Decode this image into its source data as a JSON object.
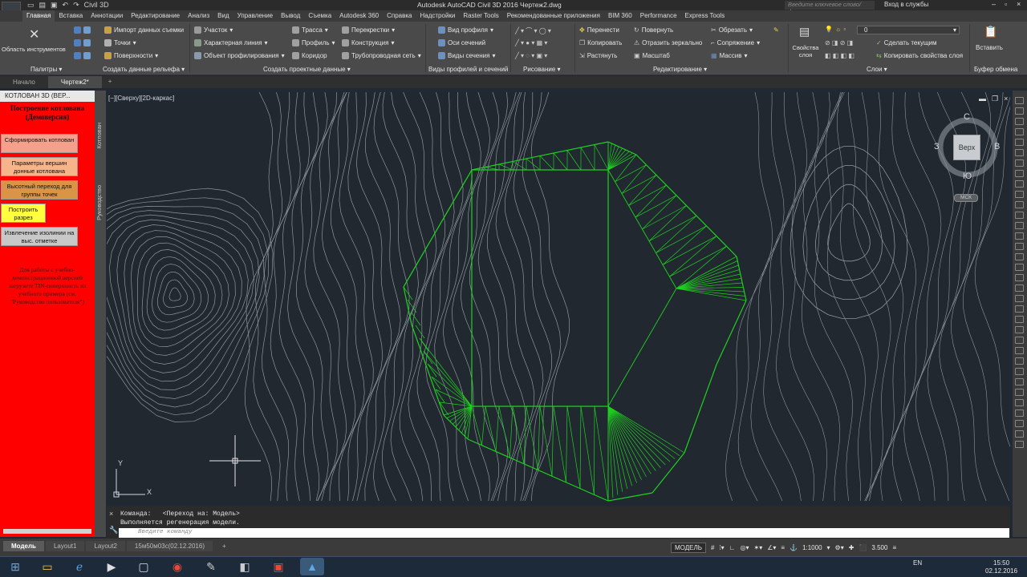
{
  "titlebar": {
    "app_name": "Civil 3D",
    "title": "Autodesk AutoCAD Civil 3D 2016   Чертеж2.dwg",
    "search_placeholder": "Введите ключевое слово/фразу",
    "login": "Вход в службы"
  },
  "logo": {
    "text": "C3D"
  },
  "menu_tabs": [
    "Главная",
    "Вставка",
    "Аннотации",
    "Редактирование",
    "Анализ",
    "Вид",
    "Управление",
    "Вывод",
    "Съемка",
    "Autodesk 360",
    "Справка",
    "Надстройки",
    "Raster Tools",
    "Рекомендованные приложения",
    "BIM 360",
    "Performance",
    "Express Tools"
  ],
  "ribbon": {
    "tool_area": "Область инструментов",
    "import": "Импорт данных съемки",
    "points": "Точки",
    "surfaces": "Поверхности",
    "parcel": "Участок",
    "feature_line": "Характерная линия",
    "grading": "Объект профилирования",
    "alignment": "Трасса",
    "profile": "Профиль",
    "corridor": "Коридор",
    "intersections": "Перекрестки",
    "assembly": "Конструкция",
    "pipe_network": "Трубопроводная сеть",
    "profile_view": "Вид профиля",
    "sample_lines": "Оси сечений",
    "section_views": "Виды сечения",
    "move": "Перенести",
    "copy": "Копировать",
    "stretch": "Растянуть",
    "rotate": "Повернуть",
    "mirror": "Отразить зеркально",
    "scale": "Масштаб",
    "trim": "Обрезать",
    "fillet": "Сопряжение",
    "array": "Массив",
    "layer_props": "Свойства слоя",
    "layer_value": "0",
    "make_current": "Сделать текущим",
    "match_layer": "Копировать свойства слоя",
    "paste": "Вставить",
    "panels": [
      "Палитры",
      "Создать данные рельефа",
      "Создать проектные данные",
      "Виды профилей и сечений",
      "Рисование",
      "Редактирование",
      "Слои",
      "Буфер обмена"
    ]
  },
  "doc_tabs": [
    "Начало",
    "Чертеж2*"
  ],
  "palette": {
    "header": "КОТЛОВАН 3D (ВЕР...",
    "title": "Построение котлована (Демоверсия)",
    "buttons": [
      "Сформировать котлован",
      "Параметры вершин донные котлована",
      "Высотный переход для группы точек",
      "Построить разрез",
      "Извлечение изолинии на выс. отметке"
    ],
    "note": "Для работы с учебно-демонстрационной версией загрузите TIN-поверхность из учебного примера (см. \"Руководство пользователя\")",
    "side_tabs": [
      "Котлован",
      "Руководство"
    ]
  },
  "viewport": {
    "label": "[−][Сверху][2D-каркас]"
  },
  "navcube": {
    "north": "С",
    "south": "Ю",
    "west": "З",
    "east": "В",
    "face": "Верх",
    "ucs": "МСК"
  },
  "ucs_axes": {
    "y": "Y",
    "x": "X"
  },
  "command": {
    "history": [
      "Команда:   <Переход на: Модель>",
      "Выполняется регенерация модели."
    ],
    "placeholder": "Введите команду"
  },
  "layout_tabs": [
    "Модель",
    "Layout1",
    "Layout2",
    "15м50м03с(02.12.2016)"
  ],
  "status": {
    "model": "МОДЕЛЬ",
    "scale": "1:1000",
    "elevation": "3.500"
  },
  "tray": {
    "lang": "EN",
    "time": "15:50",
    "date": "02.12.2016"
  },
  "colors": {
    "palette_bg": "#ff0000",
    "canvas_bg": "#212830",
    "pit_lines": "#1fd11f",
    "contours": "#8e959c"
  }
}
